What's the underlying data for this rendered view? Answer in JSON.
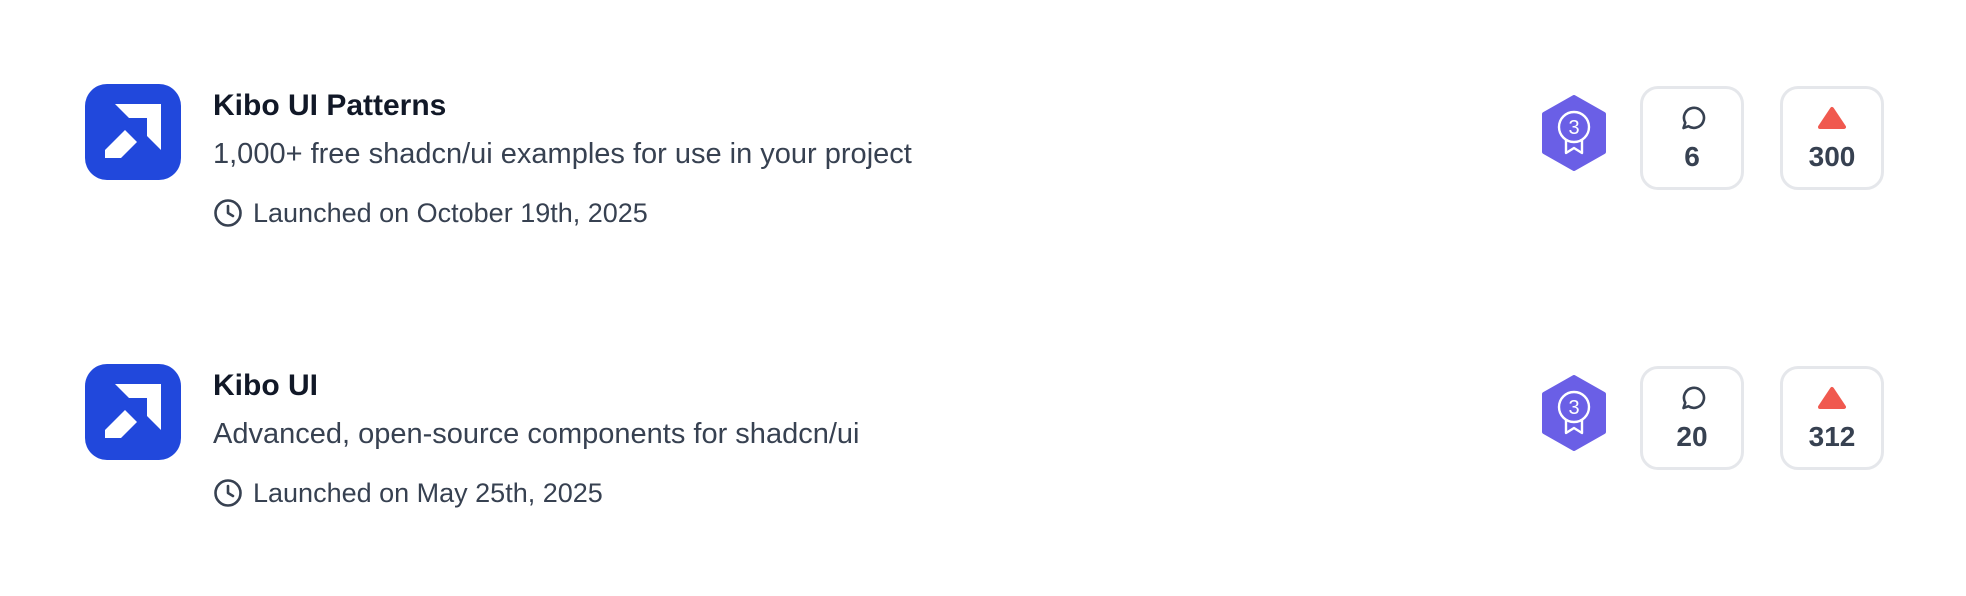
{
  "products": [
    {
      "name": "Kibo UI Patterns",
      "tagline": "1,000+ free shadcn/ui examples for use in your project",
      "launched": "Launched on October 19th, 2025",
      "badge_rank": "3",
      "comments": "6",
      "upvotes": "300",
      "logo_icon": "arrow-up-right-icon",
      "logo_color": "#2148dc"
    },
    {
      "name": "Kibo UI",
      "tagline": "Advanced, open-source components for shadcn/ui",
      "launched": "Launched on May 25th, 2025",
      "badge_rank": "3",
      "comments": "20",
      "upvotes": "312",
      "logo_icon": "arrow-up-right-icon",
      "logo_color": "#2148dc"
    }
  ],
  "icons": {
    "launch": "clock-icon",
    "comments": "message-circle-icon",
    "upvote": "upvote-triangle-icon",
    "badge": "medal-ribbon-icon"
  },
  "colors": {
    "badge": "#6a5fe6",
    "upvote": "#f0594f",
    "title": "#111827",
    "text": "#374151",
    "border": "#e5e7eb"
  }
}
